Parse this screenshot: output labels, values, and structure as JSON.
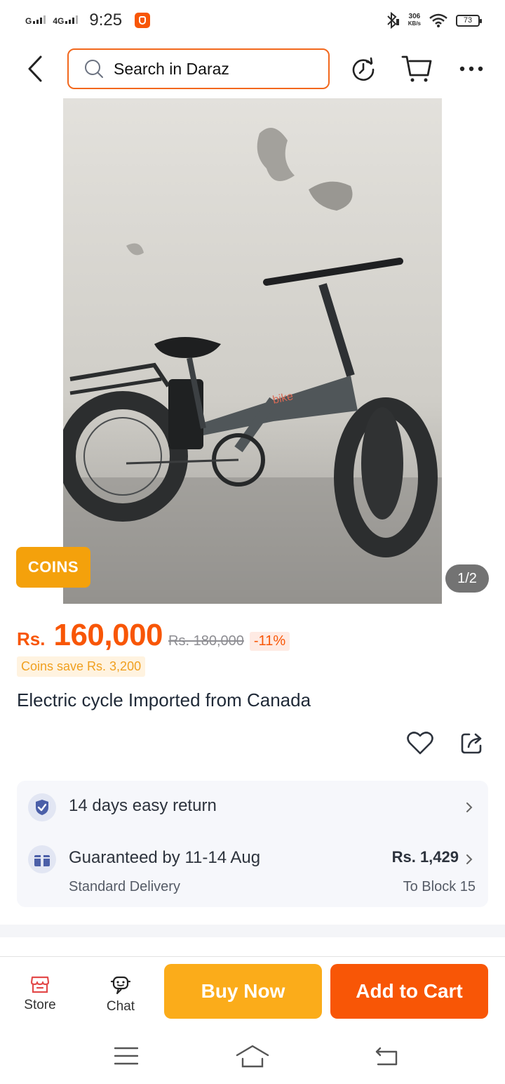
{
  "status_bar": {
    "network_1": "G",
    "network_2": "4G",
    "time": "9:25",
    "speed_value": "306",
    "speed_unit": "KB/s",
    "battery": "73"
  },
  "header": {
    "search_placeholder": "Search in Daraz",
    "icons": [
      "back-arrow-icon",
      "search-icon",
      "refresh-icon",
      "cart-icon",
      "more-icon"
    ]
  },
  "gallery": {
    "coins_badge": "COINS",
    "counter": "1/2",
    "image_subject": "folding electric fat-tire bike",
    "frame_logo": "bike"
  },
  "price": {
    "currency": "Rs.",
    "current": "160,000",
    "original": "Rs. 180,000",
    "discount": "-11%",
    "coins_save": "Coins save Rs. 3,200"
  },
  "product": {
    "title": "Electric cycle Imported from Canada"
  },
  "delivery": {
    "return_text": "14 days easy return",
    "guarantee_text": "Guaranteed by 11-14 Aug",
    "delivery_type": "Standard Delivery",
    "delivery_price": "Rs. 1,429",
    "destination": "To Block 15"
  },
  "bottom_bar": {
    "store_label": "Store",
    "chat_label": "Chat",
    "buy_now_label": "Buy Now",
    "add_to_cart_label": "Add to Cart"
  },
  "colors": {
    "brand_orange": "#f85606",
    "buy_yellow": "#fbac1a",
    "coins_gold": "#f4a10b"
  }
}
